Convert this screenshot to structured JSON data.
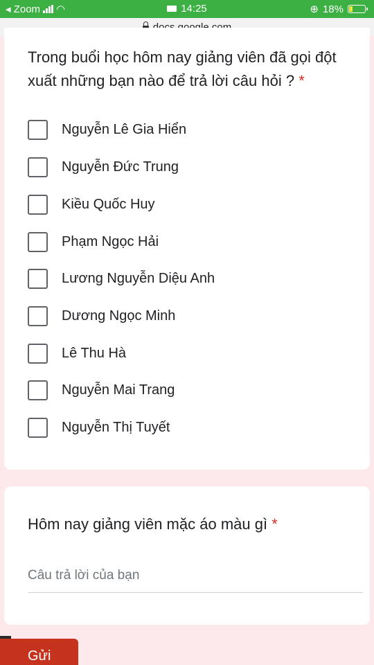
{
  "status": {
    "back_label": "◂ Zoom",
    "time": "14:25",
    "battery": "18%"
  },
  "browser": {
    "url": "docs.google.com"
  },
  "form": {
    "question1": {
      "text": "Trong buổi học hôm nay giảng viên đã gọi đột xuất những bạn nào để trả lời câu hỏi ?",
      "required_mark": "*",
      "options": [
        "Nguyễn Lê Gia Hiển",
        "Nguyễn Đức Trung",
        "Kiều Quốc Huy",
        "Phạm Ngọc Hải",
        "Lương Nguyễn Diệu Anh",
        "Dương Ngọc Minh",
        "Lê Thu Hà",
        "Nguyễn Mai Trang",
        "Nguyễn Thị Tuyết"
      ]
    },
    "question2": {
      "text": "Hôm nay giảng viên mặc áo màu gì",
      "required_mark": "*",
      "placeholder": "Câu trả lời của bạn",
      "value": ""
    },
    "submit_label": "Gửi"
  },
  "colors": {
    "status_bar": "#3cb043",
    "page_bg": "#fde9ec",
    "submit": "#c5321d",
    "required": "#d93025"
  }
}
